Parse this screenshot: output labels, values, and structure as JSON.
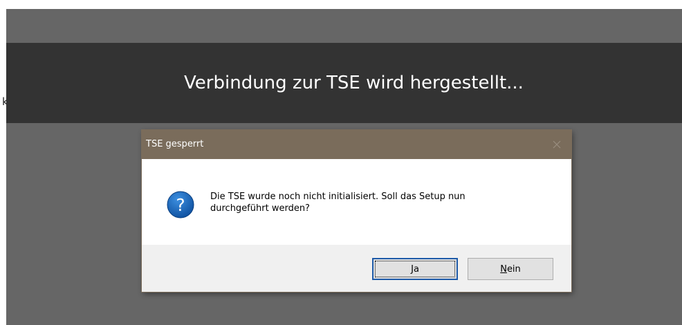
{
  "background": {
    "stray_char": "k"
  },
  "status_banner": {
    "text": "Verbindung zur TSE wird hergestellt..."
  },
  "dialog": {
    "title": "TSE gesperrt",
    "close_glyph": "✕",
    "icon": "question-icon",
    "message_line1": "Die TSE wurde noch nicht initialisiert. Soll das Setup nun",
    "message_line2": "durchgeführt werden?",
    "buttons": {
      "yes": {
        "mnemonic": "J",
        "rest": "a"
      },
      "no": {
        "mnemonic": "N",
        "rest": "ein"
      }
    }
  },
  "colors": {
    "titlebar": "#7a6c5b",
    "banner": "#333333",
    "backdrop": "#666666",
    "icon_blue": "#1565c0",
    "focus_border": "#1e5aa8"
  }
}
